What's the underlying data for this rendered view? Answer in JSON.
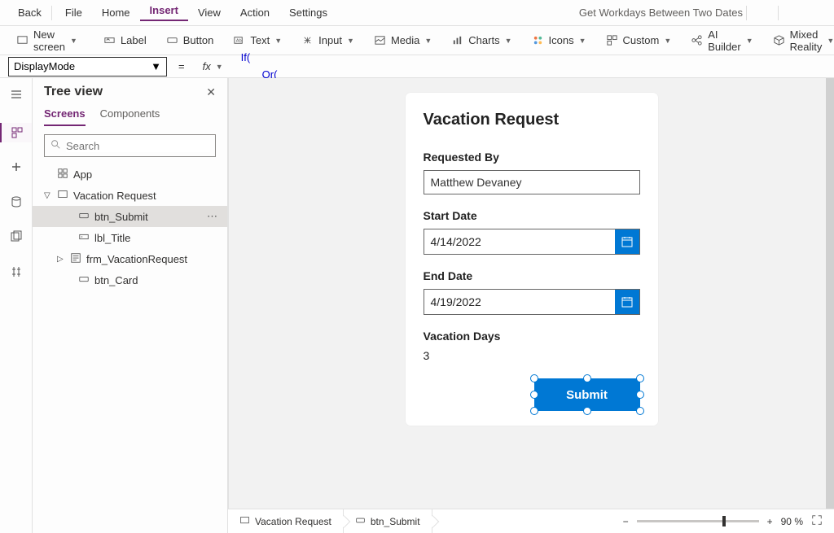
{
  "menubar": {
    "back": "Back",
    "items": [
      "File",
      "Home",
      "Insert",
      "View",
      "Action",
      "Settings"
    ],
    "active_index": 2,
    "app_title": "Get Workdays Between Two Dates"
  },
  "ribbon": {
    "new_screen": "New screen",
    "label": "Label",
    "button": "Button",
    "text": "Text",
    "input": "Input",
    "media": "Media",
    "charts": "Charts",
    "icons": "Icons",
    "custom": "Custom",
    "ai_builder": "AI Builder",
    "mixed_reality": "Mixed Reality"
  },
  "formula_bar": {
    "property": "DisplayMode",
    "fx": "fx",
    "formula_line1": "If(",
    "formula_line2": "Or("
  },
  "tree": {
    "title": "Tree view",
    "tabs": [
      "Screens",
      "Components"
    ],
    "active_tab": 0,
    "search_placeholder": "Search",
    "items": {
      "app": "App",
      "screen": "Vacation Request",
      "btn_submit": "btn_Submit",
      "lbl_title": "lbl_Title",
      "frm": "frm_VacationRequest",
      "btn_card": "btn_Card"
    }
  },
  "form": {
    "title": "Vacation Request",
    "requested_by_label": "Requested By",
    "requested_by_value": "Matthew Devaney",
    "start_date_label": "Start Date",
    "start_date_value": "4/14/2022",
    "end_date_label": "End Date",
    "end_date_value": "4/19/2022",
    "vacation_days_label": "Vacation Days",
    "vacation_days_value": "3",
    "submit_label": "Submit"
  },
  "breadcrumb": {
    "screen": "Vacation Request",
    "control": "btn_Submit"
  },
  "zoom": {
    "percent": "90",
    "unit": "%"
  }
}
